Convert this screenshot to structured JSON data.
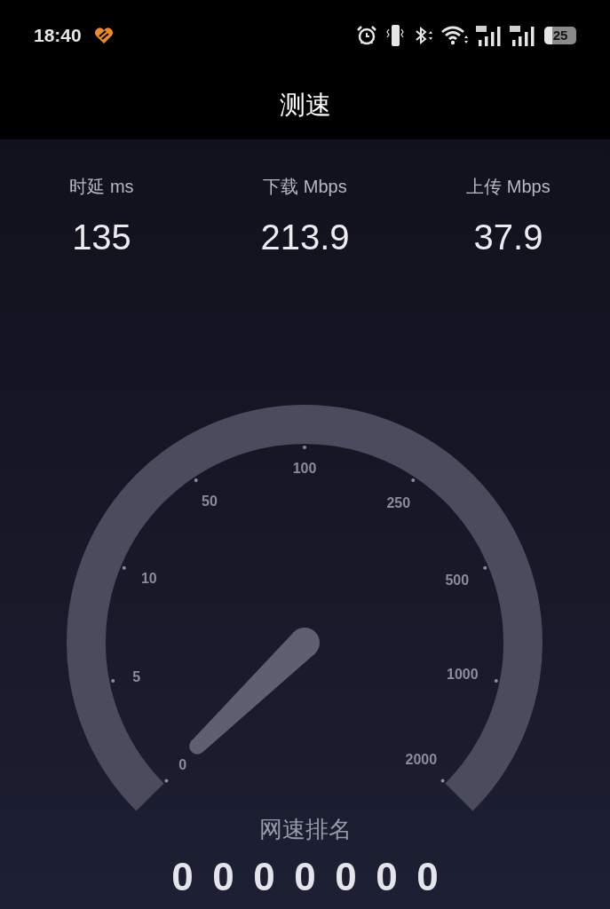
{
  "status_bar": {
    "time": "18:40",
    "battery": "25"
  },
  "title": "测速",
  "stats": [
    {
      "label": "时延 ms",
      "value": "135"
    },
    {
      "label": "下载 Mbps",
      "value": "213.9"
    },
    {
      "label": "上传 Mbps",
      "value": "37.9"
    }
  ],
  "gauge": {
    "ticks": [
      "0",
      "5",
      "10",
      "50",
      "100",
      "250",
      "500",
      "1000",
      "2000"
    ]
  },
  "ranking": {
    "label": "网速排名",
    "digits": [
      "0",
      "0",
      "0",
      "0",
      "0",
      "0",
      "0"
    ]
  }
}
